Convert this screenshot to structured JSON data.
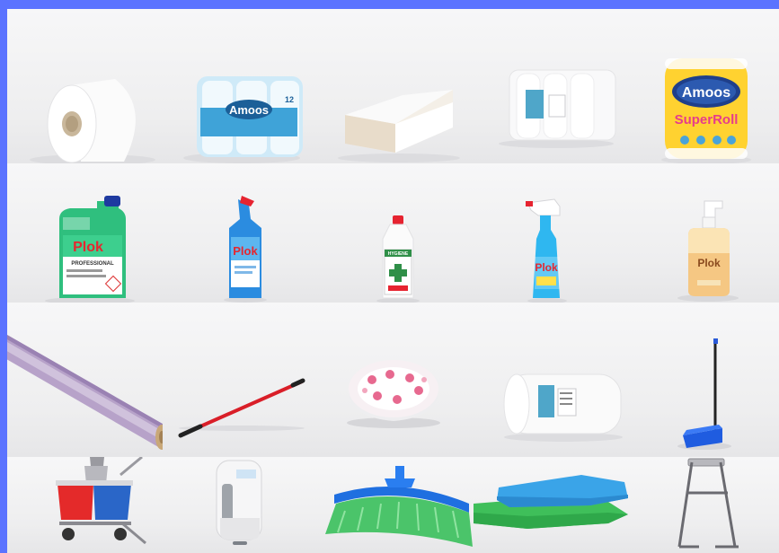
{
  "products": [
    {
      "id": "jumbo-toilet-roll",
      "text": ""
    },
    {
      "id": "toilet-paper-pack",
      "brand": "Amoos",
      "count": "12"
    },
    {
      "id": "folded-hand-towels",
      "text": ""
    },
    {
      "id": "towel-rolls-pack",
      "text": ""
    },
    {
      "id": "kitchen-roll",
      "brand": "Amoos",
      "product": "SuperRoll"
    },
    {
      "id": "floor-cleaner-jug",
      "brand": "Plok",
      "subtitle": "PROFESSIONAL"
    },
    {
      "id": "wc-gel-bottle",
      "brand": "Plok"
    },
    {
      "id": "bleach-bottle",
      "brand": "HYGIENE"
    },
    {
      "id": "glass-cleaner-spray",
      "brand": "Plok"
    },
    {
      "id": "hand-soap-pump",
      "brand": "Plok"
    },
    {
      "id": "stretch-film-roll",
      "text": ""
    },
    {
      "id": "broom-handle",
      "text": ""
    },
    {
      "id": "paper-plates",
      "text": ""
    },
    {
      "id": "industrial-roll",
      "text": ""
    },
    {
      "id": "dustpan",
      "text": ""
    },
    {
      "id": "mop-trolley",
      "text": ""
    },
    {
      "id": "soap-dispenser",
      "text": ""
    },
    {
      "id": "broom-head",
      "text": ""
    },
    {
      "id": "microfiber-cloths",
      "text": ""
    },
    {
      "id": "roll-stand",
      "text": ""
    }
  ],
  "colors": {
    "frame": "#5b73ff",
    "tile_bg": "#f2f2f3"
  }
}
